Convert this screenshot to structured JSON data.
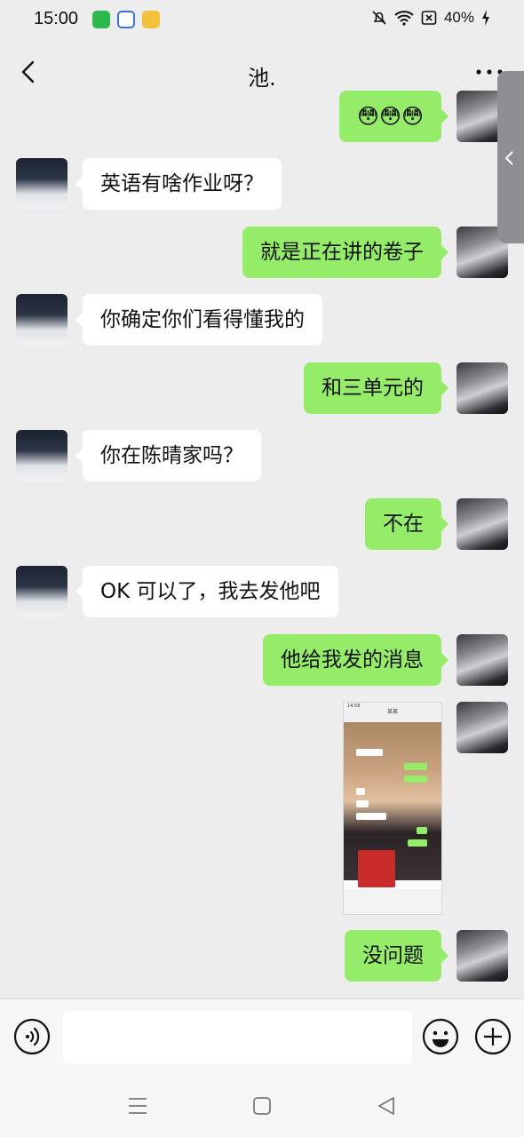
{
  "status": {
    "time": "15:00",
    "battery": "40%"
  },
  "header": {
    "title": "池."
  },
  "messages": [
    {
      "side": "right",
      "text": "😳😳😳",
      "emoji": true
    },
    {
      "side": "left",
      "text": "英语有啥作业呀？"
    },
    {
      "side": "right",
      "text": "就是正在讲的卷子"
    },
    {
      "side": "left",
      "text": "你确定你们看得懂我的"
    },
    {
      "side": "right",
      "text": "和三单元的"
    },
    {
      "side": "left",
      "text": "你在陈晴家吗？"
    },
    {
      "side": "right",
      "text": "不在"
    },
    {
      "side": "left",
      "text": "OK 可以了，我去发他吧"
    },
    {
      "side": "right",
      "text": "他给我发的消息"
    },
    {
      "side": "right",
      "image": true
    },
    {
      "side": "right",
      "text": "没问题"
    }
  ],
  "screenshot": {
    "time": "14:58",
    "title": "某某"
  },
  "input": {
    "placeholder": ""
  }
}
